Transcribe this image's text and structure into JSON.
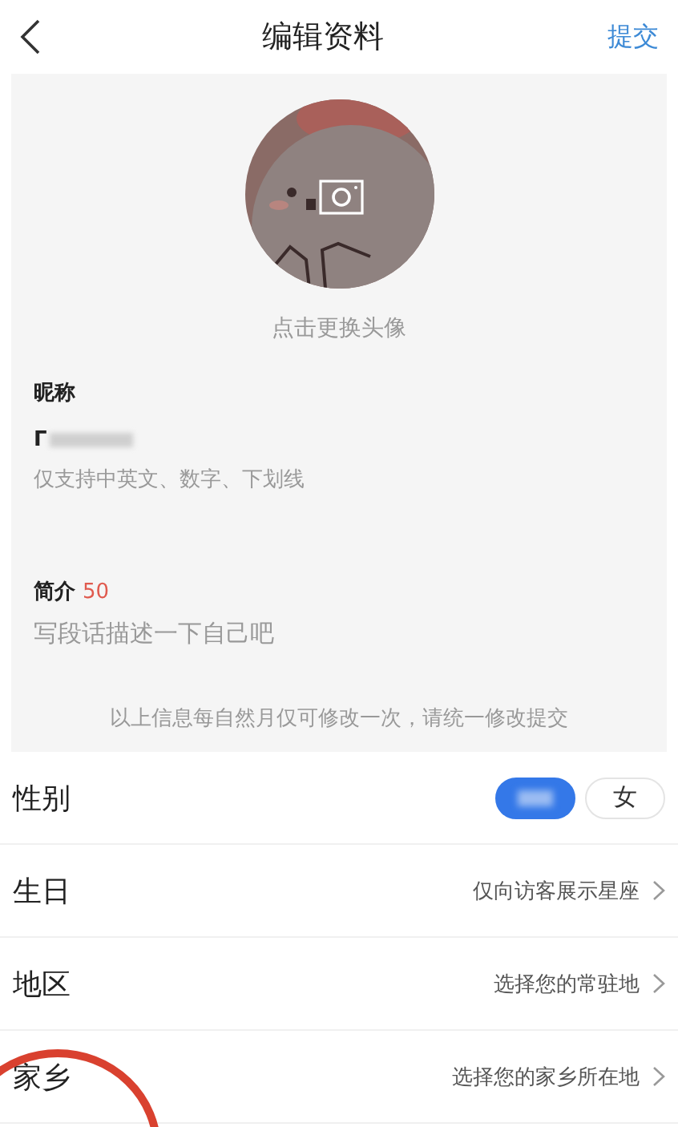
{
  "header": {
    "title": "编辑资料",
    "action": "提交"
  },
  "profile": {
    "avatar_caption": "点击更换头像",
    "nickname": {
      "label": "昵称",
      "value": "Γ",
      "redacted": true,
      "hint": "仅支持中英文、数字、下划线"
    },
    "bio": {
      "label": "简介",
      "count": "50",
      "placeholder": "写段话描述一下自己吧"
    },
    "notice": "以上信息每自然月仅可修改一次，请统一修改提交"
  },
  "rows": [
    {
      "kind": "gender",
      "label": "性别",
      "highlight": false,
      "options": [
        {
          "redacted": true,
          "selected": true
        },
        {
          "label": "女",
          "redacted": false,
          "selected": false
        }
      ]
    },
    {
      "kind": "link",
      "label": "生日",
      "value": "仅向访客展示星座",
      "highlight": false
    },
    {
      "kind": "link",
      "label": "地区",
      "value": "选择您的常驻地",
      "highlight": false
    },
    {
      "kind": "link",
      "label": "家乡",
      "value": "选择您的家乡所在地",
      "highlight": true
    }
  ]
}
